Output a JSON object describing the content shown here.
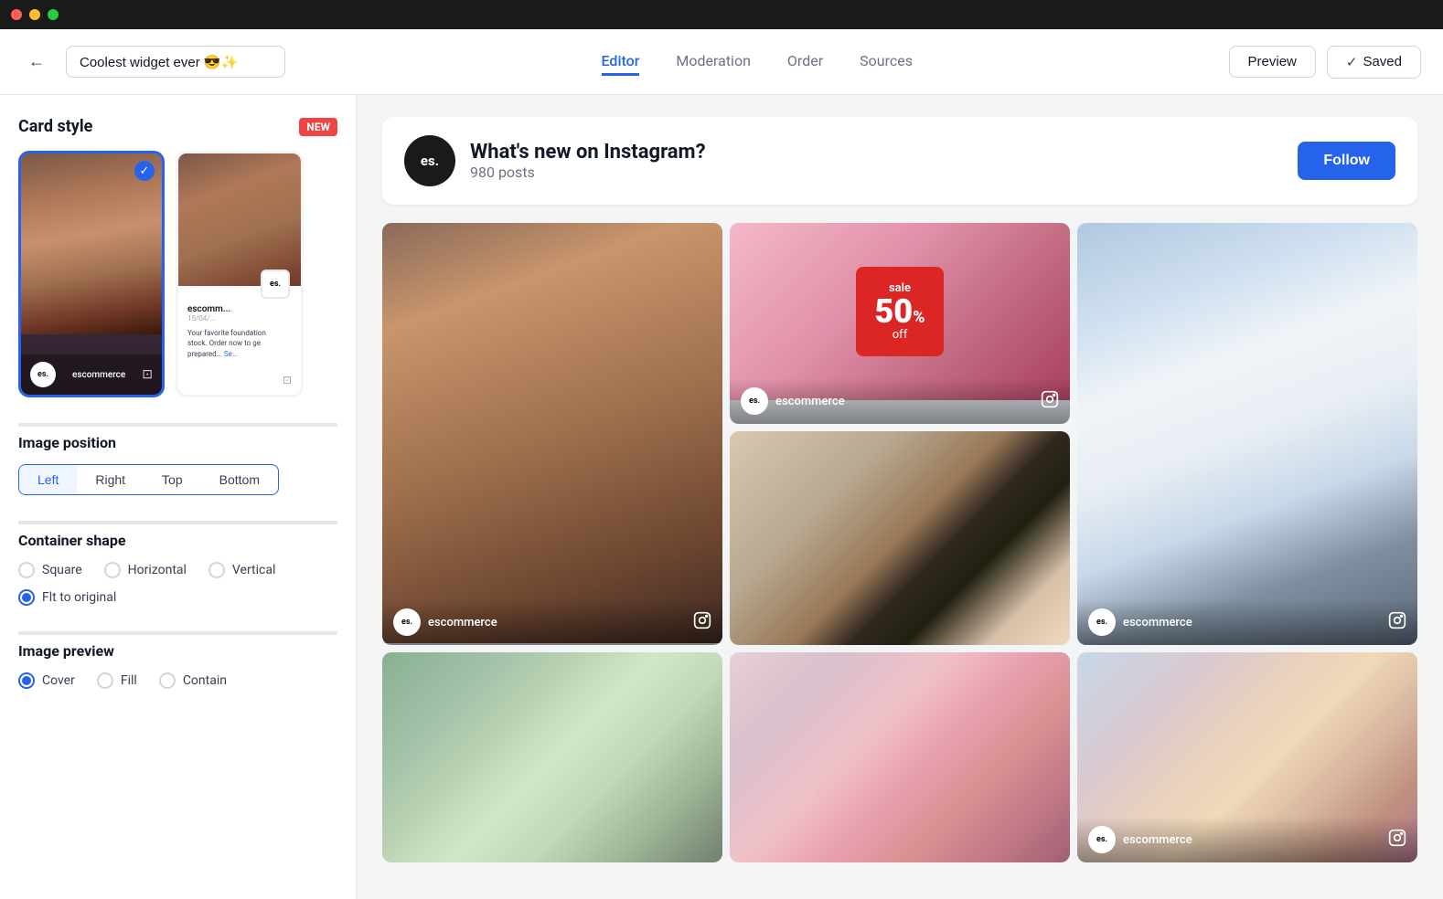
{
  "titlebar": {
    "dots": [
      "red",
      "yellow",
      "green"
    ]
  },
  "topnav": {
    "project_name": "Coolest widget ever 😎✨",
    "edit_icon": "✏",
    "tabs": [
      {
        "id": "editor",
        "label": "Editor",
        "active": true
      },
      {
        "id": "moderation",
        "label": "Moderation",
        "active": false
      },
      {
        "id": "order",
        "label": "Order",
        "active": false
      },
      {
        "id": "sources",
        "label": "Sources",
        "active": false
      }
    ],
    "preview_label": "Preview",
    "saved_label": "Saved",
    "check_icon": "✓"
  },
  "sidebar": {
    "card_style": {
      "title": "Card style",
      "new_badge": "NEW",
      "options": [
        {
          "id": "portrait",
          "selected": true
        },
        {
          "id": "list",
          "selected": false
        }
      ]
    },
    "image_position": {
      "title": "Image position",
      "options": [
        {
          "id": "left",
          "label": "Left",
          "selected": true
        },
        {
          "id": "right",
          "label": "Right",
          "selected": false
        },
        {
          "id": "top",
          "label": "Top",
          "selected": false
        },
        {
          "id": "bottom",
          "label": "Bottom",
          "selected": false
        }
      ]
    },
    "container_shape": {
      "title": "Container shape",
      "options": [
        {
          "id": "square",
          "label": "Square",
          "selected": false
        },
        {
          "id": "horizontal",
          "label": "Horizontal",
          "selected": false
        },
        {
          "id": "vertical",
          "label": "Vertical",
          "selected": false
        },
        {
          "id": "fit",
          "label": "Flt to original",
          "selected": true
        }
      ]
    },
    "image_preview": {
      "title": "Image preview",
      "options": [
        {
          "id": "cover",
          "label": "Cover",
          "selected": true
        },
        {
          "id": "fill",
          "label": "Fill",
          "selected": false
        },
        {
          "id": "contain",
          "label": "Contain",
          "selected": false
        }
      ]
    }
  },
  "widget": {
    "logo_text": "es.",
    "title": "What's new on Instagram?",
    "posts_count": "980 posts",
    "follow_label": "Follow"
  },
  "grid": {
    "items": [
      {
        "id": "fashion-face",
        "brand": "escommerce",
        "span": "tall"
      },
      {
        "id": "sale",
        "brand": "escommerce",
        "span": "normal"
      },
      {
        "id": "jeans",
        "brand": "escommerce",
        "span": "tall"
      },
      {
        "id": "shoes",
        "brand": "",
        "span": "normal"
      },
      {
        "id": "shop",
        "brand": "",
        "span": "normal"
      },
      {
        "id": "people",
        "brand": "escommerce",
        "span": "normal"
      },
      {
        "id": "flowers",
        "brand": "",
        "span": "normal"
      }
    ]
  },
  "colors": {
    "accent": "#2563eb",
    "danger": "#ef4444",
    "text_primary": "#111827",
    "text_secondary": "#6b7280"
  }
}
